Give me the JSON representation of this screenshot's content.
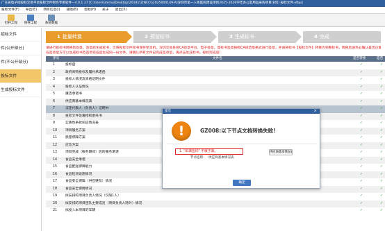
{
  "window": {
    "title": "广东省电子招投标交易平台投标文件制作专用软件—4.0.1.17 [C:\\Users\\mimu\\Desktop\\20181\\2[NECG2025000149-A]深圳市第一人民医院建设项目2025-2026学年办公室用品采购项目(B包) 投标文件.etbp]"
  },
  "menu": {
    "items": [
      "投标文件(F)",
      "导出(E)",
      "项目信息(I)",
      "辅助(B)",
      "帮助(H)",
      "关于",
      "退出(X)"
    ]
  },
  "toolbar": {
    "items": [
      {
        "label": "打开工程",
        "icon": "open-folder-icon",
        "color": "#e8b94a"
      },
      {
        "label": "保存工程",
        "icon": "save-disk-icon",
        "color": "#4a7fc1"
      },
      {
        "label": "系统数据",
        "icon": "monitor-icon",
        "color": "#6a8fb5"
      }
    ]
  },
  "sidebar": {
    "items": [
      {
        "label": "招标文件"
      },
      {
        "label": "件(公开部分)"
      },
      {
        "label": "件(不公开部分)"
      },
      {
        "label": "投标文件",
        "active": true
      },
      {
        "label": "生成投标文件"
      }
    ]
  },
  "steps": [
    {
      "num": "1",
      "label": "批量转换"
    },
    {
      "num": "2",
      "label": "预览标书"
    },
    {
      "num": "3",
      "label": "生成标书"
    },
    {
      "num": "4",
      "label": "完成"
    }
  ],
  "notice": {
    "line1": "请进行投标书转换后签章，签章后生成标书，可将投标文件标书保存至本机，深圳交易系统CA签章平台、电子签章，等标书签章按照CA规范等格式进行签章，并请将标书【投标文件】转换为完整标书，转换后请务必确认是否正确签章，请注意生成投标文件",
    "line2": "在签章后方可以生成标书及签章完成后生成同一份文件。请确认所有文件已完成签章后，再点击生成标书。投标完成后！"
  },
  "table": {
    "headers": {
      "no": "序号",
      "name": "文件名",
      "col3": "是否转换",
      "col4": "是否"
    },
    "rows": [
      {
        "no": "1",
        "name": "投标函",
        "ok": "✓",
        "ok2": "✓"
      },
      {
        "no": "2",
        "name": "政府采购投标及履约承诺函",
        "ok": "✓",
        "ok2": "✓"
      },
      {
        "no": "3",
        "name": "投标人情况及资格证明文件",
        "ok": "✓",
        "ok2": "✓"
      },
      {
        "no": "4",
        "name": "投标人认证情况",
        "ok": "✓",
        "ok2": "✓"
      },
      {
        "no": "5",
        "name": "廉洁承诺书",
        "ok": "✓",
        "ok2": "✓"
      },
      {
        "no": "6",
        "name": "供应商基本情况表",
        "ok": "✓",
        "ok2": "✓"
      },
      {
        "no": "7",
        "name": "法定代表人（负责人）证明书",
        "ok": "✓",
        "ok2": "✓",
        "selected": true
      },
      {
        "no": "8",
        "name": "投标文件签署授权委托书",
        "ok": "✓",
        "ok2": "✓"
      },
      {
        "no": "9",
        "name": "实质性条款响应情况表",
        "ok": "✓",
        "ok2": "✓"
      },
      {
        "no": "10",
        "name": "项目服务方案",
        "ok": "✓",
        "ok2": "✓"
      },
      {
        "no": "11",
        "name": "质量保障方案",
        "ok": "✓",
        "ok2": "✓"
      },
      {
        "no": "12",
        "name": "应急方案",
        "ok": "✓",
        "ok2": "✓"
      },
      {
        "no": "13",
        "name": "项目完成（服务期间）后的服务承诺",
        "ok": "✓",
        "ok2": "✓"
      },
      {
        "no": "14",
        "name": "食品安全承诺",
        "ok": "✓",
        "ok2": "✓"
      },
      {
        "no": "15",
        "name": "食品配送保障能力",
        "ok": "✓",
        "ok2": "✓"
      },
      {
        "no": "16",
        "name": "食品检测设施情况",
        "ok": "✓",
        "ok2": "✓"
      },
      {
        "no": "17",
        "name": "食品安全保障（供应链及）情况",
        "ok": "✓",
        "ok2": "✓"
      },
      {
        "no": "18",
        "name": "食品安全保障情况",
        "ok": "✓",
        "ok2": "✓"
      },
      {
        "no": "19",
        "name": "拟安排的项目负责人情况（仅限1人）",
        "ok": "✓",
        "ok2": "✓"
      },
      {
        "no": "20",
        "name": "拟安排的项目团队主要成员（项目负责人除外）情况",
        "ok": "✓",
        "ok2": "✓"
      },
      {
        "no": "21",
        "name": "拟投入本项目的车辆",
        "ok": "✓",
        "ok2": "✓"
      }
    ]
  },
  "dialog": {
    "title": "提示",
    "close": "×",
    "message": "GZ008:以下节点文档转换失败!",
    "detail_error": "1. \"年满签印\" 不属于表。",
    "detail_label": "节点名称:",
    "detail_value": "供应商基本情况表",
    "side_button": "供应商基本情况表",
    "ok_button": "确定"
  },
  "colors": {
    "title_bar": "#2f5f9c",
    "step_active": "#e99b2c",
    "step_inactive": "#cfcfcf",
    "check": "#2d9b2d",
    "error": "#e02020",
    "warning": "#ee8411"
  }
}
